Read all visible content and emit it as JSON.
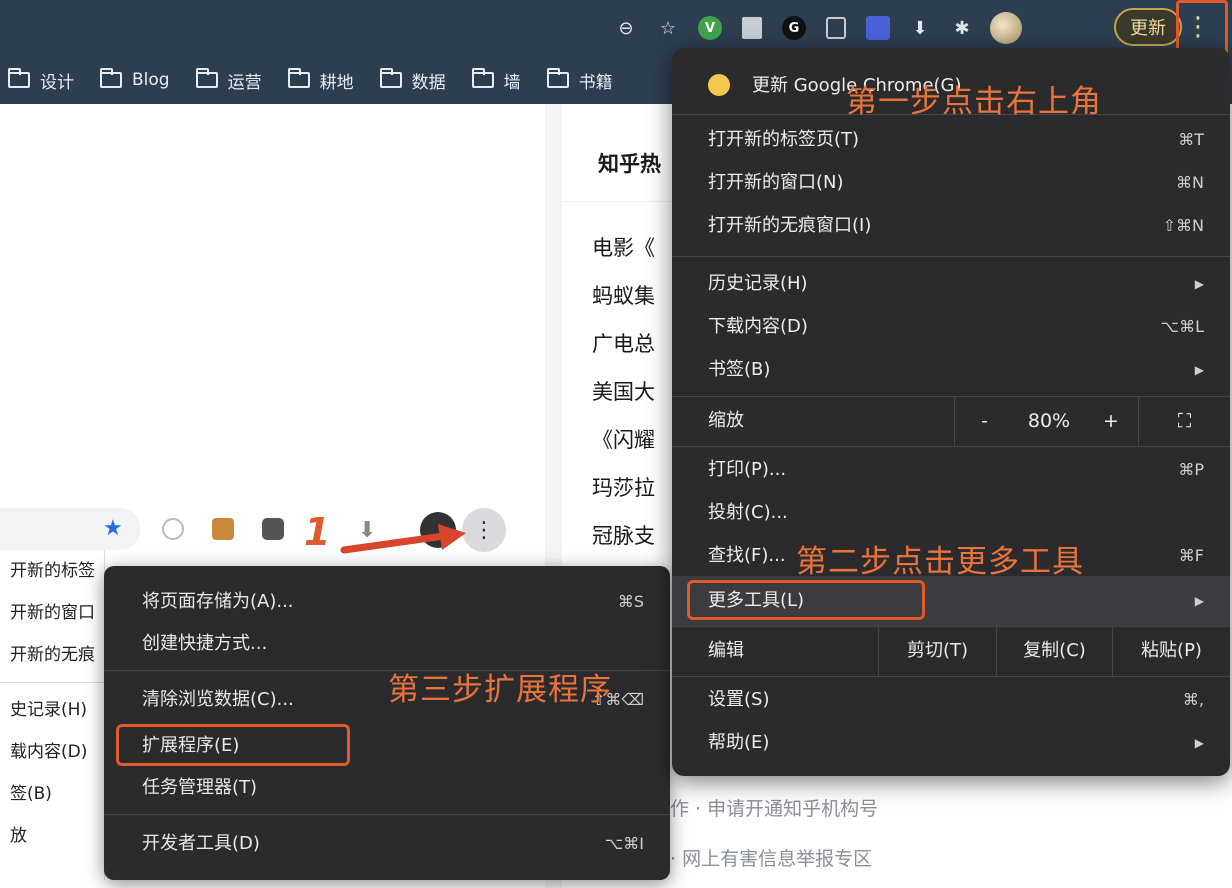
{
  "toolbar": {
    "update_button": "更新",
    "kebab_icon": "⋮"
  },
  "bookmarks": [
    "设计",
    "Blog",
    "运营",
    "耕地",
    "数据",
    "墙",
    "书籍"
  ],
  "page": {
    "hot_title": "知乎热",
    "hot_items": [
      "电影《",
      "蚂蚁集",
      "广电总",
      "美国大",
      "《闪耀",
      "玛莎拉",
      "冠脉支"
    ],
    "footer_links": [
      "作 · 申请开通知乎机构号",
      "· 网上有害信息举报专区"
    ]
  },
  "inner": {
    "step_number": "1",
    "partial_menu": [
      "开新的标签",
      "开新的窗口",
      "开新的无痕",
      "史记录(H)",
      "载内容(D)",
      "签(B)",
      "放"
    ]
  },
  "menu": {
    "update": "更新 Google Chrome(G)",
    "new_tab": "打开新的标签页(T)",
    "new_tab_sc": "⌘T",
    "new_window": "打开新的窗口(N)",
    "new_window_sc": "⌘N",
    "incognito": "打开新的无痕窗口(I)",
    "incognito_sc": "⇧⌘N",
    "history": "历史记录(H)",
    "downloads": "下载内容(D)",
    "downloads_sc": "⌥⌘L",
    "bookmarks": "书签(B)",
    "zoom": "缩放",
    "zoom_minus": "-",
    "zoom_value": "80%",
    "zoom_plus": "+",
    "fullscreen": "⛶",
    "print": "打印(P)...",
    "print_sc": "⌘P",
    "cast": "投射(C)...",
    "find": "查找(F)...",
    "find_sc": "⌘F",
    "more_tools": "更多工具(L)",
    "edit": "编辑",
    "cut": "剪切(T)",
    "copy": "复制(C)",
    "paste": "粘贴(P)",
    "settings": "设置(S)",
    "settings_sc": "⌘,",
    "help": "帮助(E)"
  },
  "submenu": {
    "save_page": "将页面存储为(A)...",
    "save_page_sc": "⌘S",
    "create_shortcut": "创建快捷方式...",
    "clear_data": "清除浏览数据(C)...",
    "clear_data_sc": "⇧⌘⌫",
    "extensions": "扩展程序(E)",
    "task_manager": "任务管理器(T)",
    "dev_tools": "开发者工具(D)",
    "dev_tools_sc": "⌥⌘I"
  },
  "annotations": {
    "step1": "第一步点击右上角",
    "step2": "第二步点击更多工具",
    "step3": "第三步扩展程序"
  },
  "colors": {
    "accent_annotation": "#e8733b",
    "menu_bg": "#2b2b2d",
    "titlebar_bg": "#2c3e50"
  }
}
